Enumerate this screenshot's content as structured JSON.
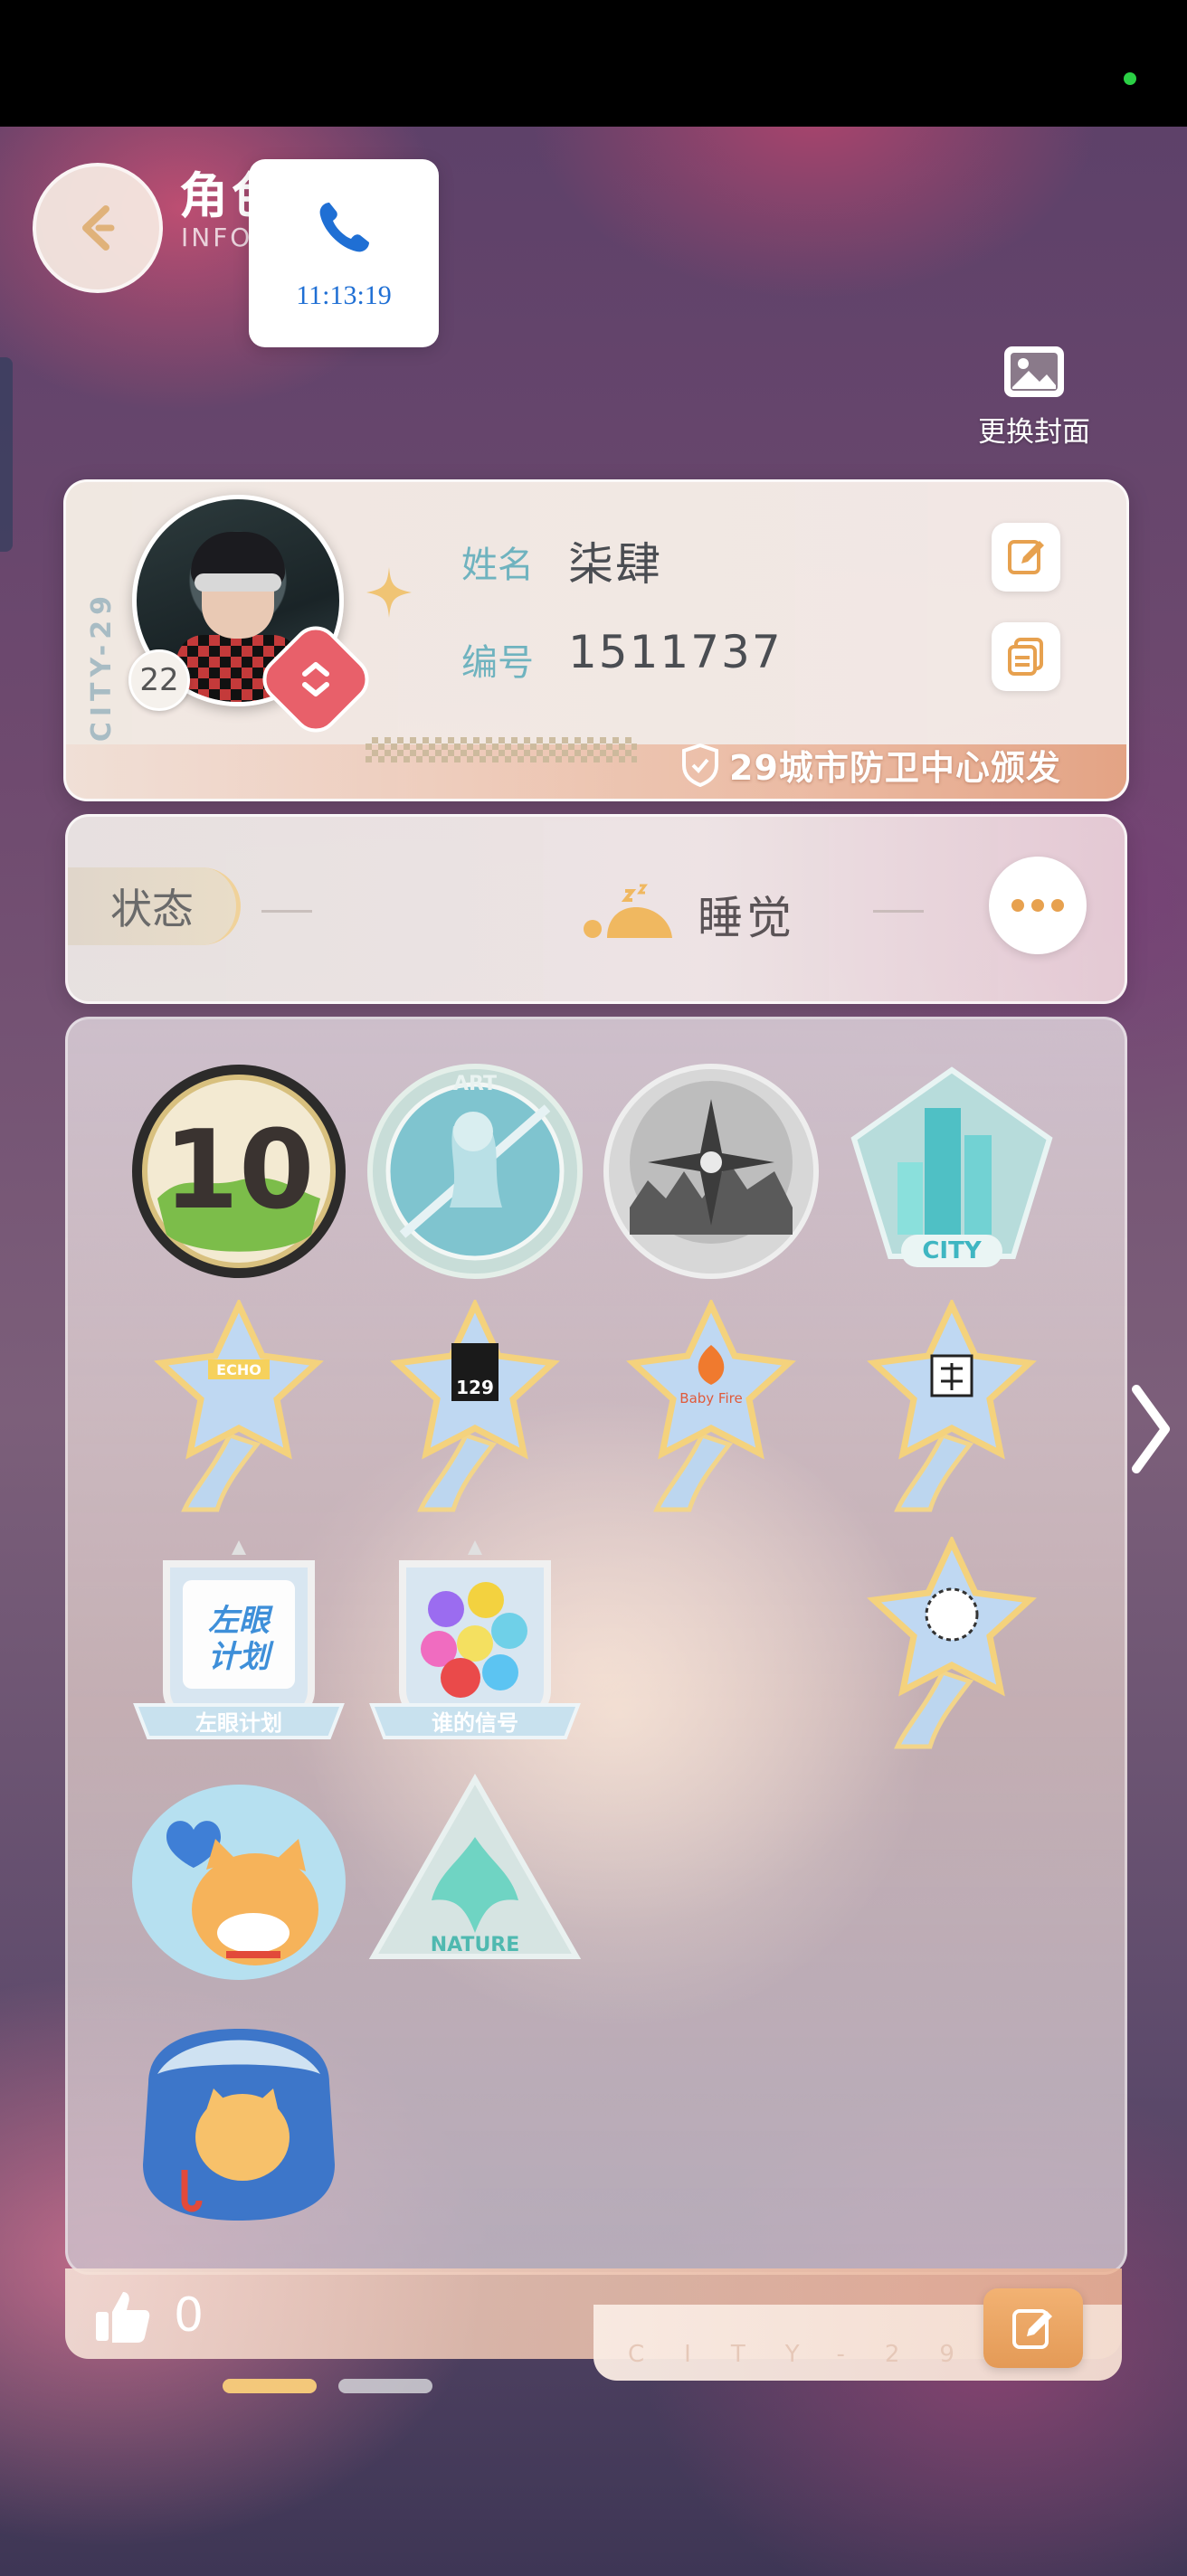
{
  "status_bar": {
    "indicator_color": "#2bd045"
  },
  "header": {
    "title": "角色",
    "subtitle": "INFO"
  },
  "call_overlay": {
    "time": "11:13:19",
    "icon": "phone-icon"
  },
  "cover": {
    "label": "更换封面",
    "icon": "image-icon"
  },
  "id_card": {
    "vertical_text": "CITY-29",
    "level": "22",
    "name_label": "姓名",
    "name_value": "柒肆",
    "id_label": "编号",
    "id_value": "1511737",
    "issuer": "29城市防卫中心颁发",
    "accent_color": "#e7a14f"
  },
  "status": {
    "tab_label": "状态",
    "value": "睡觉",
    "more_icon": "more-dots-icon"
  },
  "badges": [
    {
      "name": "badge-10",
      "text": "10"
    },
    {
      "name": "badge-art",
      "text": "ART"
    },
    {
      "name": "badge-compass",
      "text": ""
    },
    {
      "name": "badge-city",
      "text": "CITY"
    },
    {
      "name": "star-echo",
      "text": "ECHO"
    },
    {
      "name": "star-129",
      "text": "129"
    },
    {
      "name": "star-babyfire",
      "text": "Baby Fire"
    },
    {
      "name": "star-glyph",
      "text": ""
    },
    {
      "name": "shield-zuoyan",
      "text": "左眼计划"
    },
    {
      "name": "shield-shui",
      "text": "谁的信号"
    },
    {
      "name": "star-wreath",
      "text": ""
    },
    {
      "name": "cat-heart",
      "text": ""
    },
    {
      "name": "triangle-nature",
      "text": "NATURE"
    },
    {
      "name": "cat-rain",
      "text": ""
    }
  ],
  "footer": {
    "likes": "0",
    "brand": "CITY-29",
    "edit_icon": "edit-icon"
  },
  "pager": {
    "pages": 2,
    "active": 0
  }
}
